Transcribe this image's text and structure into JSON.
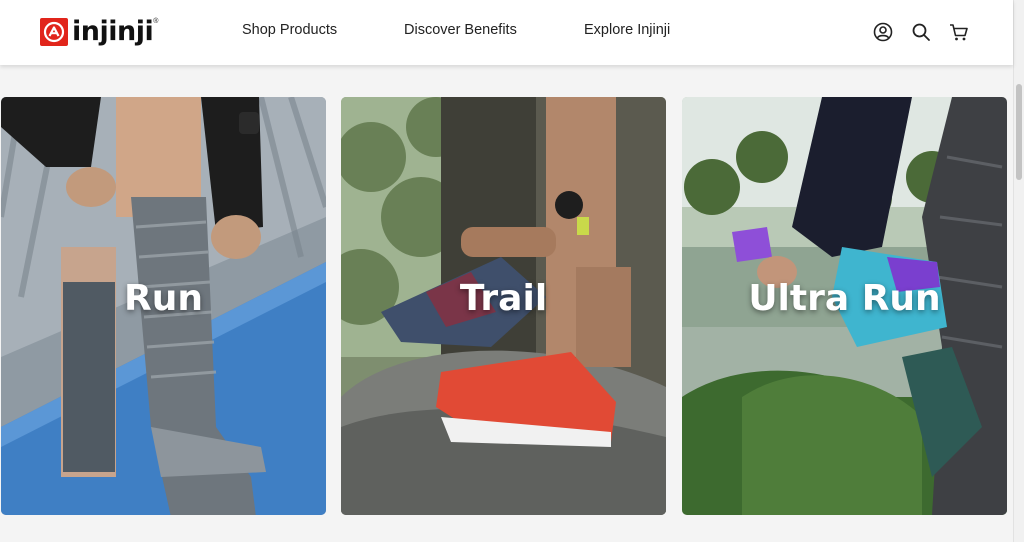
{
  "header": {
    "brand": "injinji",
    "nav": [
      {
        "label": "Shop Products"
      },
      {
        "label": "Discover Benefits"
      },
      {
        "label": "Explore Injinji"
      }
    ],
    "icons": [
      "account-icon",
      "search-icon",
      "cart-icon"
    ]
  },
  "categories": [
    {
      "title": "Run"
    },
    {
      "title": "Trail"
    },
    {
      "title": "Ultra Run"
    }
  ],
  "colors": {
    "brand_red": "#e1251b",
    "text_dark": "#222222",
    "background": "#f4f4f4"
  }
}
